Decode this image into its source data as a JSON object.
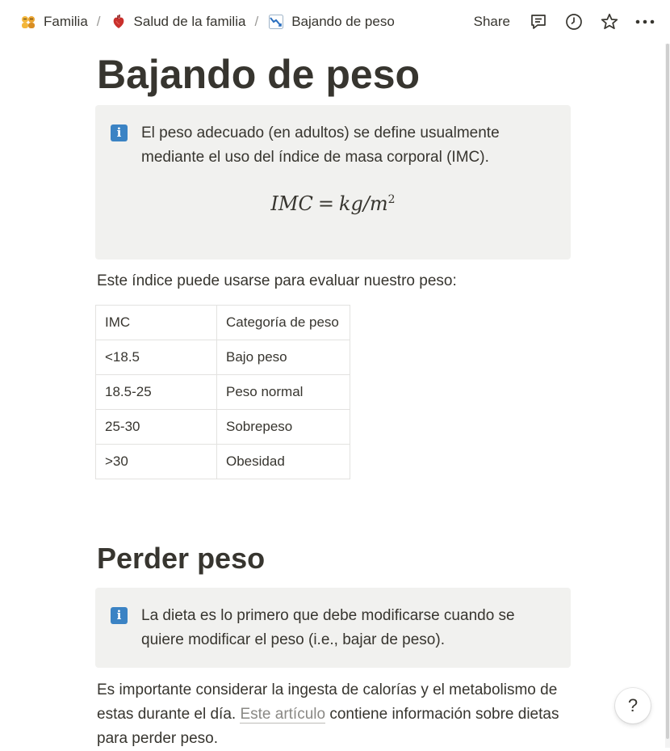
{
  "breadcrumb": [
    {
      "label": "Familia",
      "icon": "family-emoji-icon"
    },
    {
      "label": "Salud de la familia",
      "icon": "anatomical-heart-icon"
    },
    {
      "label": "Bajando de peso",
      "icon": "chart-decreasing-icon"
    }
  ],
  "breadcrumb_separator": "/",
  "topbar": {
    "share_label": "Share",
    "icons": [
      "comments-icon",
      "history-icon",
      "favorite-star-icon",
      "more-icon"
    ]
  },
  "page": {
    "title": "Bajando de peso",
    "callout1": {
      "icon": "info-icon",
      "icon_glyph": "i",
      "text": "El peso adecuado (en adultos) se define usualmente mediante el uso del índice de masa corporal (IMC).",
      "equation": {
        "lhs": "IMC",
        "op": "=",
        "rhs": "kg/m",
        "exponent": "2"
      }
    },
    "paragraph1": "Este índice puede usarse para evaluar nuestro peso:",
    "table": {
      "rows": [
        [
          "IMC",
          "Categoría de peso"
        ],
        [
          "<18.5",
          "Bajo peso"
        ],
        [
          "18.5-25",
          "Peso normal"
        ],
        [
          "25-30",
          "Sobrepeso"
        ],
        [
          ">30",
          "Obesidad"
        ]
      ]
    },
    "heading2": "Perder peso",
    "callout2": {
      "icon": "info-icon",
      "icon_glyph": "i",
      "text": "La dieta es lo primero que debe modificarse cuando se quiere modificar el peso (i.e., bajar de peso)."
    },
    "paragraph2": {
      "before": "Es importante considerar la ingesta de calorías y el metabolismo de estas durante el día. ",
      "link": "Este artículo",
      "after": " contiene información sobre dietas para perder peso."
    }
  },
  "help_button": "?",
  "colors": {
    "text": "#37352f",
    "callout_bg": "#f1f1ef",
    "info_blue": "#3b83c4",
    "link_gray": "#8a8985"
  }
}
